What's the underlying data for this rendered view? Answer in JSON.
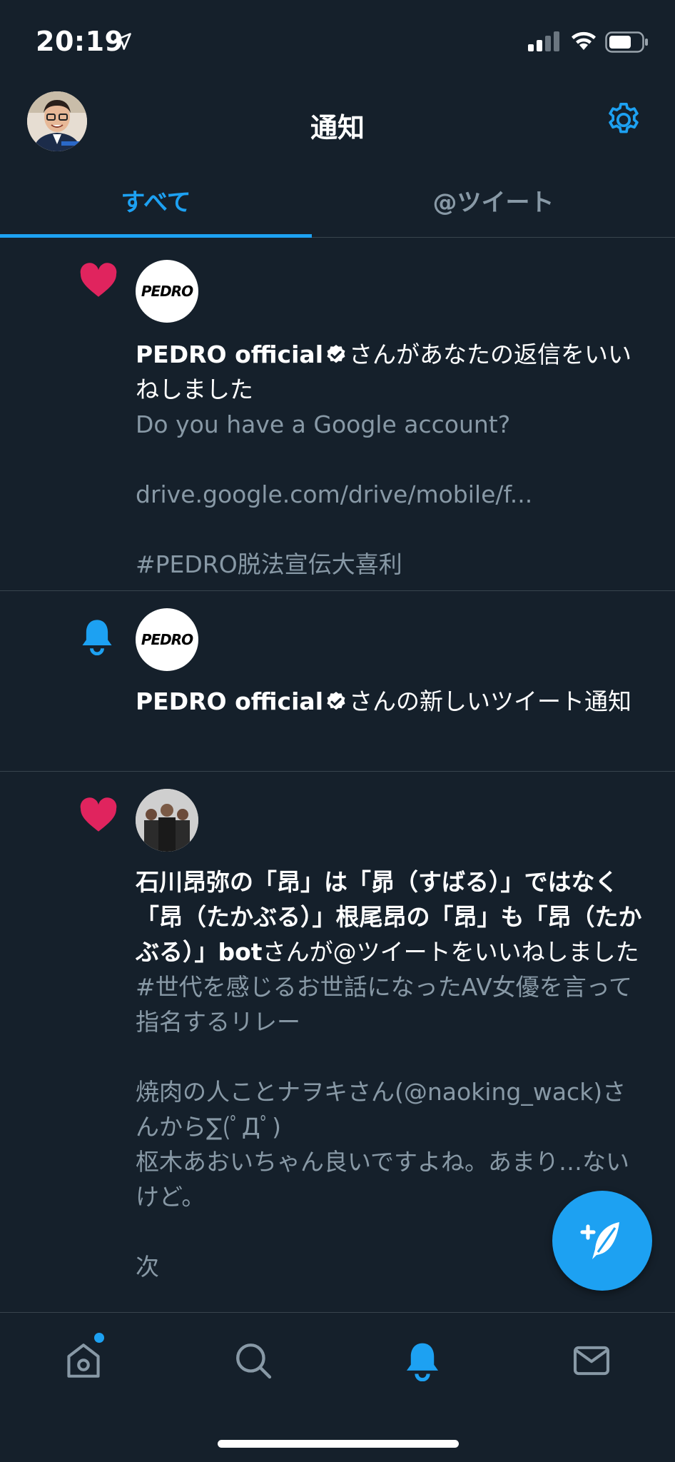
{
  "status_bar": {
    "time": "20:19"
  },
  "header": {
    "title": "通知"
  },
  "tabs": [
    {
      "label": "すべて",
      "active": true
    },
    {
      "label": "@ツイート",
      "active": false
    }
  ],
  "notifications": [
    {
      "icon": "heart-icon",
      "avatar_label": "PEDRO",
      "actor": "PEDRO official",
      "verified": true,
      "action": "さんがあなたの返信をいいねしました",
      "tweet_text": "Do you have a Google account?\n\ndrive.google.com/drive/mobile/f...\n\n#PEDRO脱法宣伝大喜利"
    },
    {
      "icon": "bell-icon",
      "avatar_label": "PEDRO",
      "actor": "PEDRO official",
      "verified": true,
      "action": "さんの新しいツイート通知",
      "tweet_text": ""
    },
    {
      "icon": "heart-icon",
      "actor": "石川昂弥の「昂」は「昴（すばる）」ではなく「昂（たかぶる）」根尾昂の「昂」も「昂（たかぶる）」bot",
      "verified": false,
      "action": "さんが@ツイートをいいねしました",
      "tweet_text": "#世代を感じるお世話になったAV女優を言って指名するリレー\n\n焼肉の人ことナヲキさん(@naoking_wack)さんから∑(ﾟДﾟ)\n枢木あおいちゃん良いですよね。あまり…ないけど。\n\n次"
    }
  ],
  "colors": {
    "background": "#15202b",
    "accent": "#1da1f2",
    "like": "#e0245e",
    "secondary_text": "#8899a6",
    "divider": "#38444d"
  }
}
